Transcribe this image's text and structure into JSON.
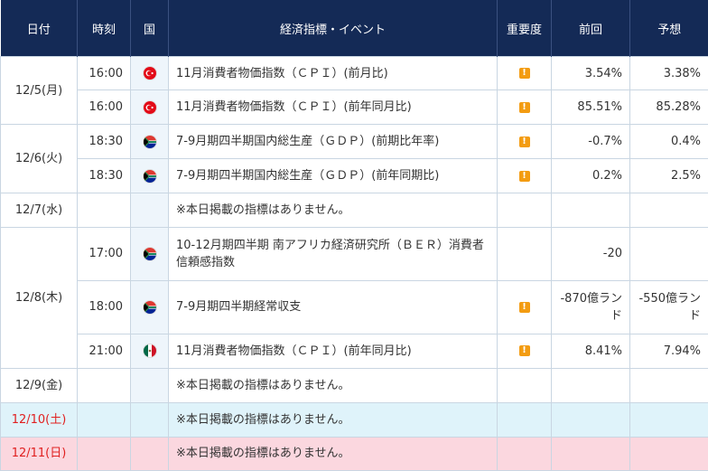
{
  "headers": {
    "date": "日付",
    "time": "時刻",
    "country": "国",
    "event": "経済指標・イベント",
    "importance": "重要度",
    "previous": "前回",
    "forecast": "予想"
  },
  "icons": {
    "turkey": "turkey-flag-icon",
    "south_africa": "south-africa-flag-icon",
    "mexico": "mexico-flag-icon",
    "importance": "exclamation-warning-icon"
  },
  "colors": {
    "header_bg": "#142a56",
    "importance": "#f39c12",
    "saturday_bg": "#dff3fa",
    "sunday_bg": "#fbd7df",
    "weekend_text": "#e02020"
  },
  "days": [
    {
      "date": "12/5(月)",
      "events": [
        {
          "time": "16:00",
          "event": "11月消費者物価指数（ＣＰＩ）(前月比)",
          "previous": "3.54%",
          "forecast": "3.38%"
        },
        {
          "time": "16:00",
          "event": "11月消費者物価指数（ＣＰＩ）(前年同月比)",
          "previous": "85.51%",
          "forecast": "85.28%"
        }
      ]
    },
    {
      "date": "12/6(火)",
      "events": [
        {
          "time": "18:30",
          "event": "7-9月期四半期国内総生産（ＧＤＰ）(前期比年率)",
          "previous": "-0.7%",
          "forecast": "0.4%"
        },
        {
          "time": "18:30",
          "event": "7-9月期四半期国内総生産（ＧＤＰ）(前年同期比)",
          "previous": "0.2%",
          "forecast": "2.5%"
        }
      ]
    },
    {
      "date": "12/7(水)",
      "none": "※本日掲載の指標はありません。"
    },
    {
      "date": "12/8(木)",
      "events": [
        {
          "time": "17:00",
          "event": "10-12月期四半期 南アフリカ経済研究所（ＢＥＲ）消費者信頼感指数",
          "previous": "-20",
          "forecast": ""
        },
        {
          "time": "18:00",
          "event": "7-9月期四半期経常収支",
          "previous": "-870億ランド",
          "forecast": "-550億ランド"
        },
        {
          "time": "21:00",
          "event": "11月消費者物価指数（ＣＰＩ）(前年同月比)",
          "previous": "8.41%",
          "forecast": "7.94%"
        }
      ]
    },
    {
      "date": "12/9(金)",
      "none": "※本日掲載の指標はありません。"
    },
    {
      "date": "12/10(土)",
      "none": "※本日掲載の指標はありません。"
    },
    {
      "date": "12/11(日)",
      "none": "※本日掲載の指標はありません。"
    }
  ]
}
